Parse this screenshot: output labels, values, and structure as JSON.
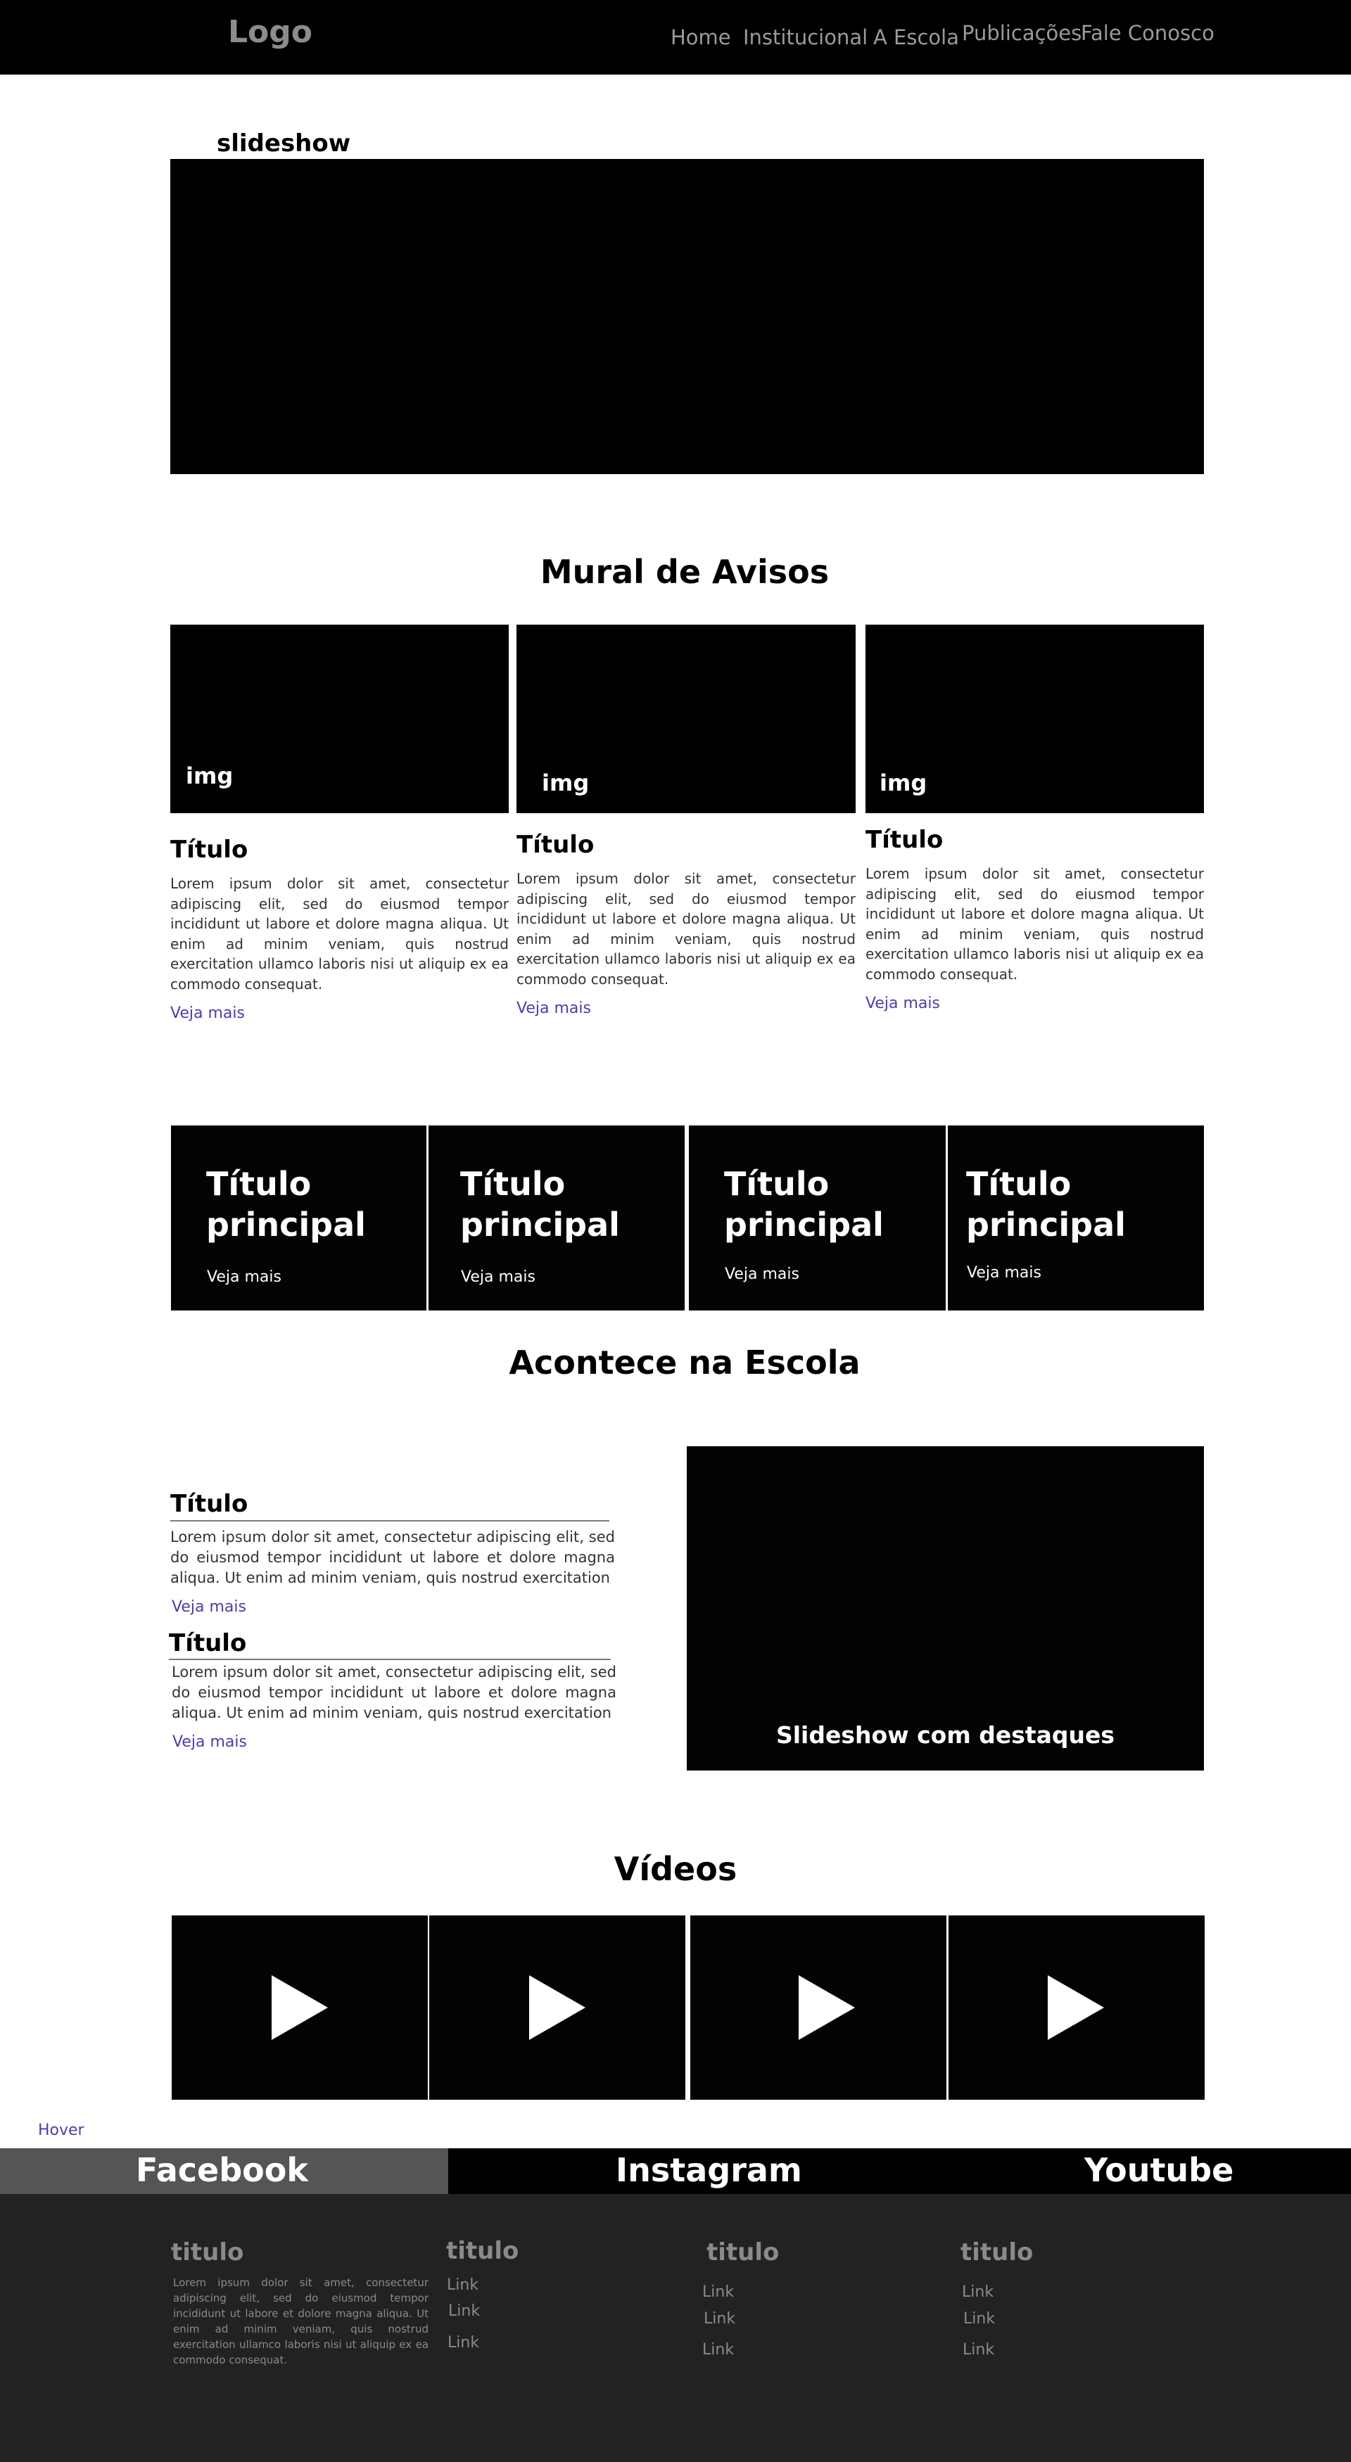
{
  "header": {
    "logo": "Logo",
    "nav": [
      "Home",
      "Institucional",
      "A Escola",
      "Publicações",
      "Fale Conosco"
    ]
  },
  "slideshow": {
    "label": "slideshow"
  },
  "mural": {
    "title": "Mural de Avisos",
    "cards": [
      {
        "img_label": "img",
        "title": "Título",
        "text": "Lorem ipsum dolor sit amet, consectetur adipiscing elit, sed do eiusmod tempor incididunt ut labore et dolore magna aliqua. Ut enim ad minim veniam, quis nostrud exercitation ullamco laboris nisi ut aliquip ex ea commodo consequat.",
        "link": "Veja mais"
      },
      {
        "img_label": "img",
        "title": "Título",
        "text": "Lorem ipsum dolor sit amet, consectetur adipiscing elit, sed do eiusmod tempor incididunt ut labore et dolore magna aliqua. Ut enim ad minim veniam, quis nostrud exercitation ullamco laboris nisi ut aliquip ex ea commodo consequat.",
        "link": "Veja mais"
      },
      {
        "img_label": "img",
        "title": "Título",
        "text": "Lorem ipsum dolor sit amet, consectetur adipiscing elit, sed do eiusmod tempor incididunt ut labore et dolore magna aliqua. Ut enim ad minim veniam, quis nostrud exercitation ullamco laboris nisi ut aliquip ex ea commodo consequat.",
        "link": "Veja mais"
      }
    ]
  },
  "tiles": [
    {
      "title": "Título principal",
      "link": "Veja mais"
    },
    {
      "title": "Título principal",
      "link": "Veja mais"
    },
    {
      "title": "Título principal",
      "link": "Veja mais"
    },
    {
      "title": "Título principal",
      "link": "Veja mais"
    }
  ],
  "acontece": {
    "title": "Acontece na Escola",
    "items": [
      {
        "title": "Título",
        "text": "Lorem ipsum dolor sit amet, consectetur adipiscing elit, sed do eiusmod tempor incididunt ut labore et dolore magna aliqua. Ut enim ad minim veniam, quis nostrud exercitation",
        "link": "Veja mais"
      },
      {
        "title": "Título",
        "text": "Lorem ipsum dolor sit amet, consectetur adipiscing elit, sed do eiusmod tempor incididunt ut labore et dolore magna aliqua. Ut enim ad minim veniam, quis nostrud exercitation",
        "link": "Veja mais"
      }
    ],
    "highlight_label": "Slideshow  com destaques"
  },
  "videos": {
    "title": "Vídeos",
    "count_icon": "play-icon"
  },
  "hover_label": "Hover",
  "social": [
    "Facebook",
    "Instagram",
    "Youtube"
  ],
  "footer": {
    "columns": [
      {
        "title": "titulo",
        "text": "Lorem ipsum dolor sit amet, consectetur adipiscing elit, sed do eiusmod tempor incididunt ut labore et dolore magna aliqua. Ut enim ad minim veniam, quis nostrud exercitation ullamco laboris nisi ut aliquip ex ea commodo consequat."
      },
      {
        "title": "titulo",
        "links": [
          "Link",
          "Link",
          "Link"
        ]
      },
      {
        "title": "titulo",
        "links": [
          "Link",
          "Link",
          "Link"
        ]
      },
      {
        "title": "titulo",
        "links": [
          "Link",
          "Link",
          "Link"
        ]
      }
    ]
  },
  "colors": {
    "header_bg": "#000000",
    "link": "#4a3fa8",
    "footer_bg": "#232223",
    "facebook_hover": "#555555"
  }
}
